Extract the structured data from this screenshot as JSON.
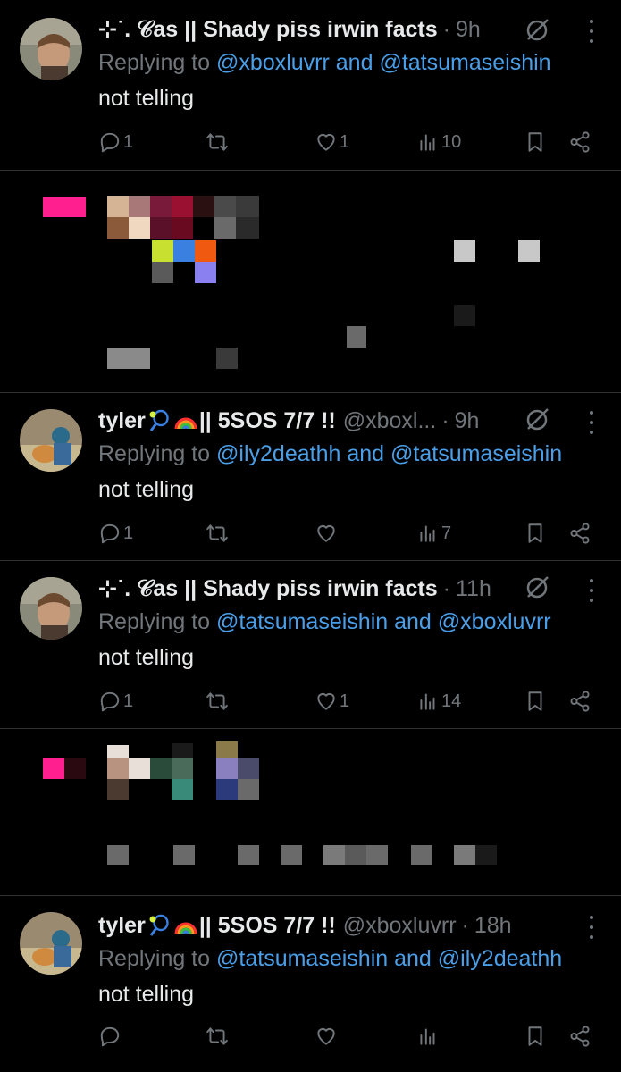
{
  "tweets": [
    {
      "display_name": "⊹˙. 𝒞as || Shady piss irwin facts",
      "handle": "",
      "time": "9h",
      "reply_prefix": "Replying to",
      "mention_1": "@xboxluvrr",
      "and": "and",
      "mention_2": "@tatsumaseishin",
      "text": "not telling",
      "replies": "1",
      "retweets": "",
      "likes": "1",
      "views": "10",
      "has_grok": true
    },
    {
      "display_name": "tyler",
      "name_suffix": "|| 5SOS 7/7 !!",
      "handle": "@xboxl...",
      "time": "9h",
      "reply_prefix": "Replying to",
      "mention_1": "@ily2deathh",
      "and": "and",
      "mention_2": "@tatsumaseishin",
      "text": "not telling",
      "replies": "1",
      "retweets": "",
      "likes": "",
      "views": "7",
      "has_grok": true
    },
    {
      "display_name": "⊹˙. 𝒞as || Shady piss irwin facts",
      "handle": "",
      "time": "11h",
      "reply_prefix": "Replying to",
      "mention_1": "@tatsumaseishin",
      "and": "and",
      "mention_2": "@xboxluvrr",
      "text": "not telling",
      "replies": "1",
      "retweets": "",
      "likes": "1",
      "views": "14",
      "has_grok": true
    },
    {
      "display_name": "tyler",
      "name_suffix": "|| 5SOS 7/7 !!",
      "handle": "@xboxluvrr",
      "time": "18h",
      "reply_prefix": "Replying to",
      "mention_1": "@tatsumaseishin",
      "and": "and",
      "mention_2": "@ily2deathh",
      "text": "not telling",
      "replies": "",
      "retweets": "",
      "likes": "",
      "views": "",
      "has_grok": false
    }
  ],
  "colors": {
    "background": "#000000",
    "text": "#e7e9ea",
    "muted": "#71767b",
    "mention": "#4a9fe8",
    "divider": "#2f3336",
    "censor_pink": "#ff1f8e"
  },
  "icons": [
    "reply-icon",
    "retweet-icon",
    "like-icon",
    "views-icon",
    "bookmark-icon",
    "share-icon",
    "grok-icon",
    "more-icon",
    "tennis-racket-emoji",
    "rainbow-emoji"
  ]
}
